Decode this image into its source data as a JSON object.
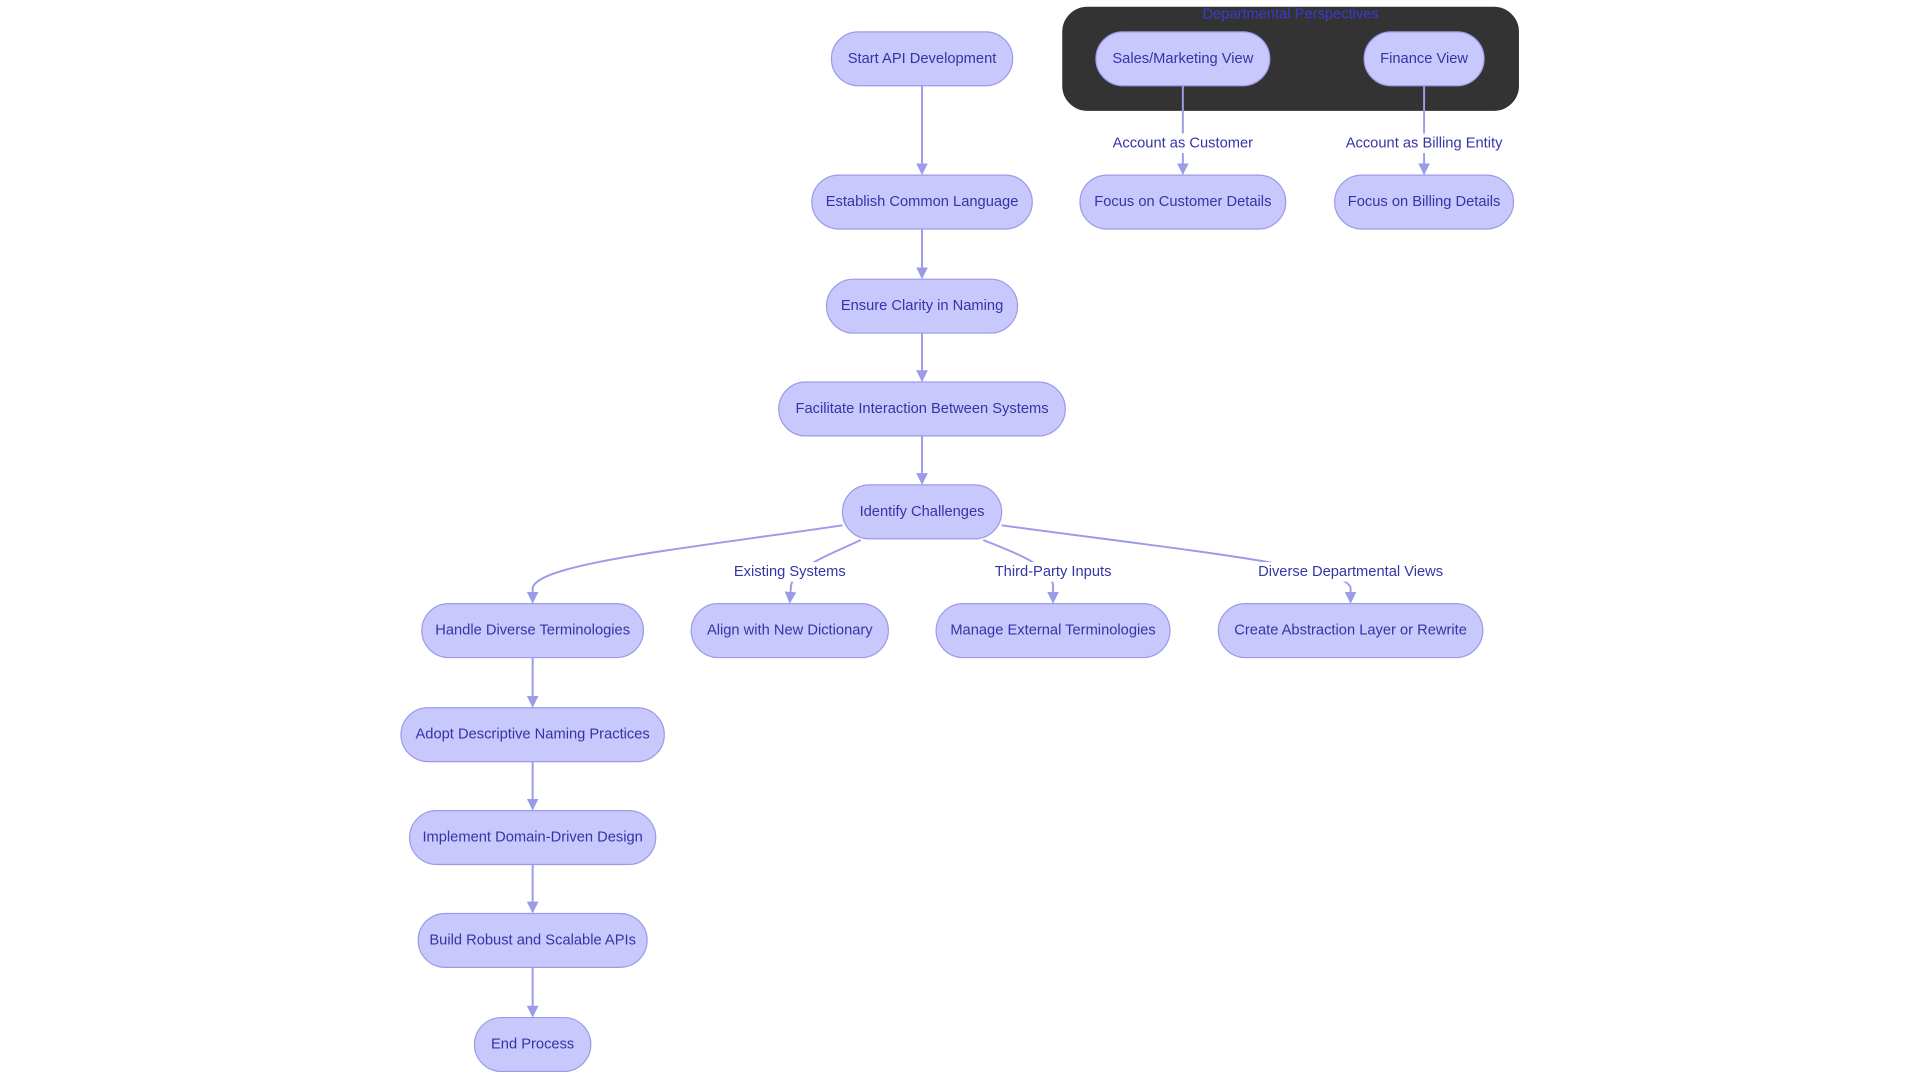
{
  "diagram": {
    "type": "flowchart",
    "colors": {
      "node_fill": "#c8c8fc",
      "node_stroke": "#9b9be8",
      "text": "#3434a8",
      "edge": "#9b9be8",
      "cluster_fill": "#333333",
      "cluster_title": "#3a3ad0"
    },
    "cluster": {
      "title": "Departmental Perspectives",
      "members": [
        "sales",
        "finance"
      ]
    },
    "nodes": {
      "start": "Start API Development",
      "establish": "Establish Common Language",
      "ensure": "Ensure Clarity in Naming",
      "facilitate": "Facilitate Interaction Between Systems",
      "identify": "Identify Challenges",
      "handle": "Handle Diverse Terminologies",
      "align": "Align with New Dictionary",
      "manage": "Manage External Terminologies",
      "create": "Create Abstraction Layer or Rewrite",
      "adopt": "Adopt Descriptive Naming Practices",
      "implement": "Implement Domain-Driven Design",
      "build": "Build Robust and Scalable APIs",
      "end": "End Process",
      "sales": "Sales/Marketing View",
      "finance": "Finance View",
      "focusCustomer": "Focus on Customer Details",
      "focusBilling": "Focus on Billing Details"
    },
    "edges": [
      {
        "from": "start",
        "to": "establish",
        "label": ""
      },
      {
        "from": "establish",
        "to": "ensure",
        "label": ""
      },
      {
        "from": "ensure",
        "to": "facilitate",
        "label": ""
      },
      {
        "from": "facilitate",
        "to": "identify",
        "label": ""
      },
      {
        "from": "identify",
        "to": "handle",
        "label": ""
      },
      {
        "from": "identify",
        "to": "align",
        "label": "Existing Systems"
      },
      {
        "from": "identify",
        "to": "manage",
        "label": "Third-Party Inputs"
      },
      {
        "from": "identify",
        "to": "create",
        "label": "Diverse Departmental Views"
      },
      {
        "from": "handle",
        "to": "adopt",
        "label": ""
      },
      {
        "from": "adopt",
        "to": "implement",
        "label": ""
      },
      {
        "from": "implement",
        "to": "build",
        "label": ""
      },
      {
        "from": "build",
        "to": "end",
        "label": ""
      },
      {
        "from": "sales",
        "to": "focusCustomer",
        "label": "Account as Customer"
      },
      {
        "from": "finance",
        "to": "focusBilling",
        "label": "Account as Billing Entity"
      }
    ]
  }
}
